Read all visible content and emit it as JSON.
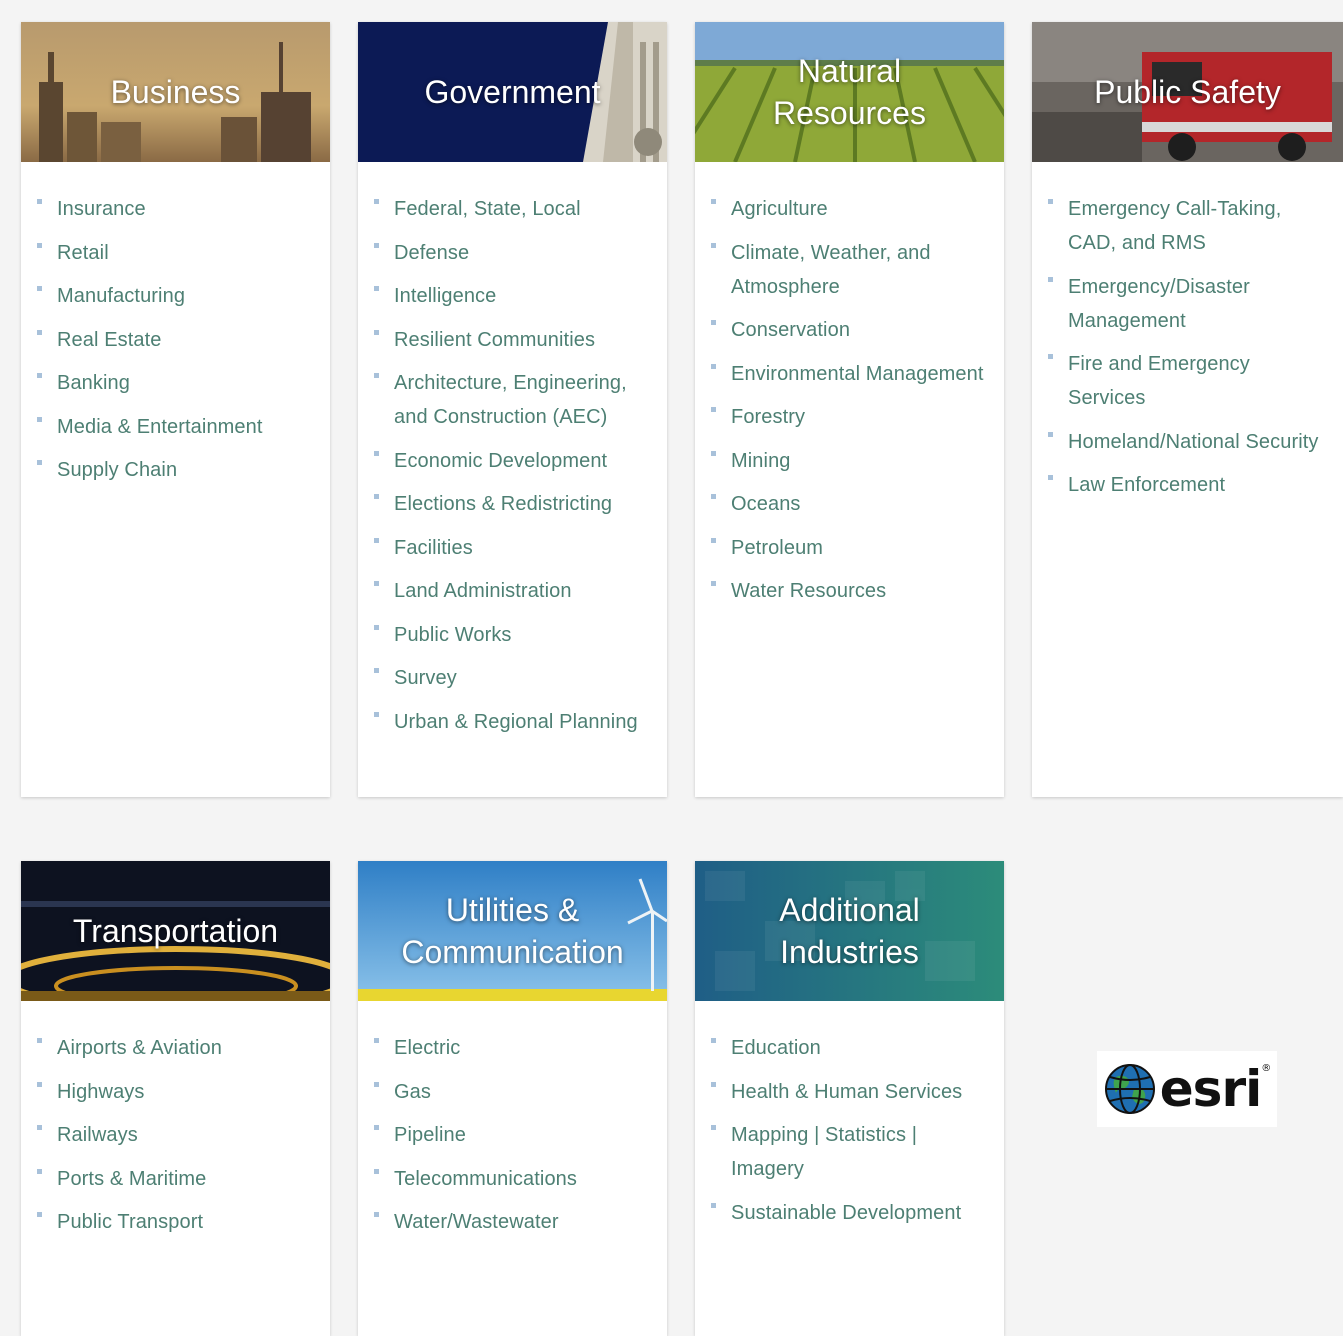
{
  "cards": [
    {
      "title": "Business",
      "items": [
        "Insurance",
        "Retail",
        "Manufacturing",
        "Real Estate",
        "Banking",
        "Media & Entertainment",
        "Supply Chain"
      ]
    },
    {
      "title": "Government",
      "items": [
        "Federal, State, Local",
        "Defense",
        "Intelligence",
        "Resilient Communities",
        "Architecture, Engineering, and Construction (AEC)",
        "Economic Development",
        "Elections & Redistricting",
        "Facilities",
        "Land Administration",
        "Public Works",
        "Survey",
        "Urban & Regional Planning"
      ]
    },
    {
      "title": "Natural\nResources",
      "items": [
        "Agriculture",
        "Climate, Weather, and Atmosphere",
        "Conservation",
        "Environmental Management",
        "Forestry",
        "Mining",
        "Oceans",
        "Petroleum",
        "Water Resources"
      ]
    },
    {
      "title": "Public Safety",
      "items": [
        "Emergency Call-Taking, CAD, and RMS",
        "Emergency/Disaster Management",
        "Fire and Emergency Services",
        "Homeland/National Security",
        "Law Enforcement"
      ]
    },
    {
      "title": "Transportation",
      "items": [
        "Airports & Aviation",
        "Highways",
        "Railways",
        "Ports & Maritime",
        "Public Transport"
      ]
    },
    {
      "title": "Utilities &\nCommunication",
      "items": [
        "Electric",
        "Gas",
        "Pipeline",
        "Telecommunications",
        "Water/Wastewater"
      ]
    },
    {
      "title": "Additional\nIndustries",
      "items": [
        "Education",
        "Health & Human Services",
        "Mapping | Statistics | Imagery",
        "Sustainable Development"
      ]
    }
  ],
  "logo": {
    "text": "esri",
    "icon": "globe-icon"
  },
  "colors": {
    "item_text": "#4d7f73",
    "bullet": "#a8c1da",
    "background": "#f4f4f4"
  }
}
